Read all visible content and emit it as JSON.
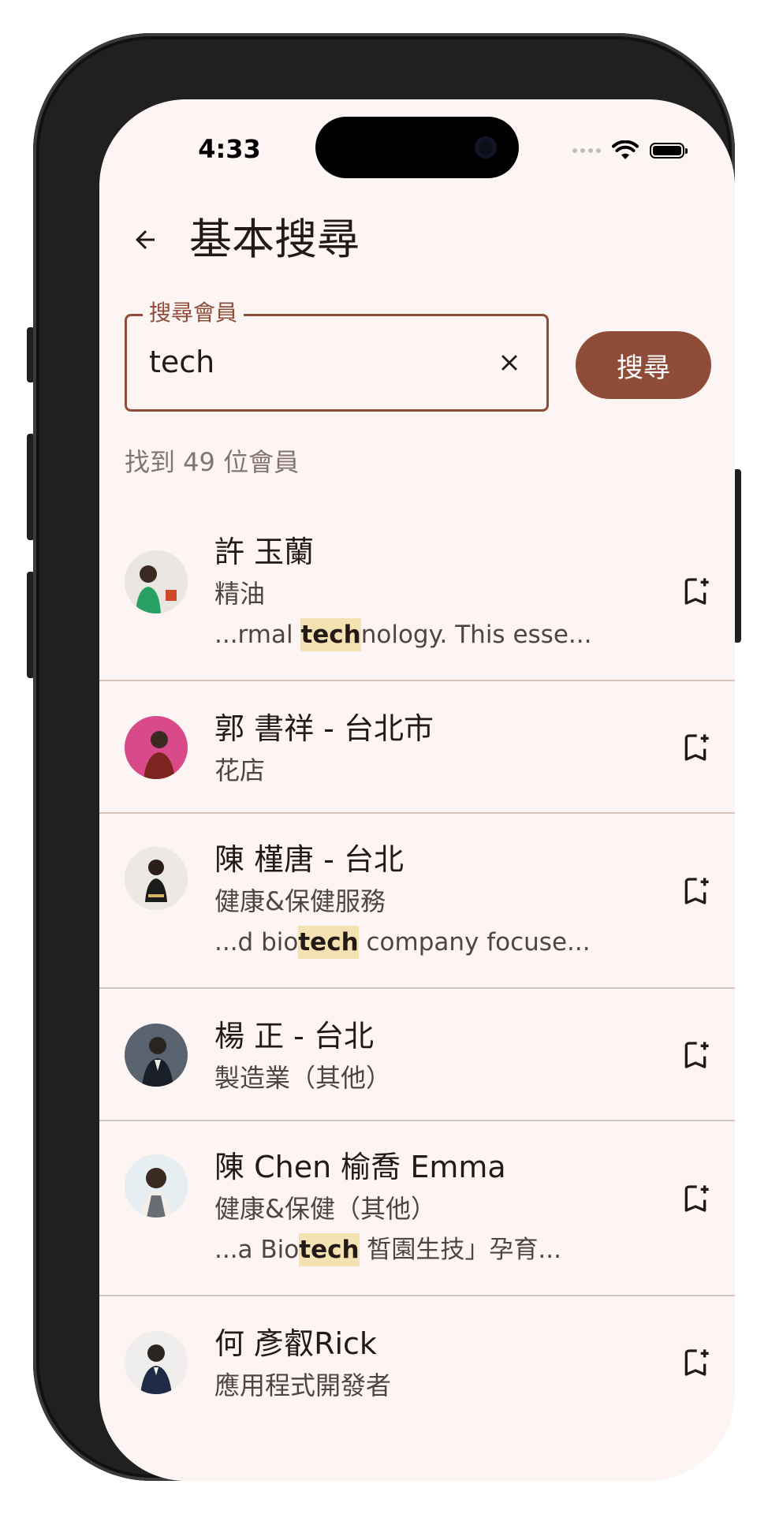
{
  "status_bar": {
    "time": "4:33"
  },
  "app_bar": {
    "title": "基本搜尋"
  },
  "search": {
    "label": "搜尋會員",
    "value": "tech",
    "button_label": "搜尋"
  },
  "results": {
    "count_text": "找到 49 位會員",
    "items": [
      {
        "name": "許 玉蘭",
        "category": "精油",
        "snippet_pre": "...rmal ",
        "snippet_hl": "tech",
        "snippet_post": "nology. This esse..."
      },
      {
        "name": "郭 書祥 - 台北市",
        "category": "花店"
      },
      {
        "name": "陳 槿唐 - 台北",
        "category": "健康&保健服務",
        "snippet_pre": "...d bio",
        "snippet_hl": "tech",
        "snippet_post": " company focuse..."
      },
      {
        "name": "楊 正 - 台北",
        "category": "製造業（其他）"
      },
      {
        "name": "陳 Chen 榆喬 Emma",
        "category": "健康&保健（其他）",
        "snippet_pre": "...a Bio",
        "snippet_hl": "tech",
        "snippet_post": " 皙園生技」孕育..."
      },
      {
        "name": "何 彥叡Rick",
        "category": "應用程式開發者"
      }
    ]
  },
  "colors": {
    "primary": "#8f4c38",
    "background": "#fdf5f3",
    "highlight": "#f4e2b2",
    "divider": "#d8c2bc"
  }
}
